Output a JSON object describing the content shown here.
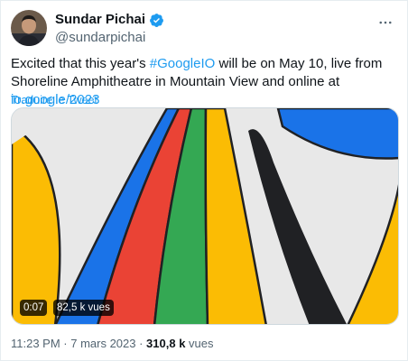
{
  "author": {
    "name": "Sundar Pichai",
    "handle": "@sundarpichai",
    "verified_color": "#1d9bf0"
  },
  "tweet": {
    "text_before": "Excited that this year's ",
    "hashtag": "#GoogleIO",
    "text_middle": " will be on May 10, live from Shoreline Amphitheatre in Mountain View and online at ",
    "url": "io.google/2023",
    "translate_label": "Traduire le Tweet"
  },
  "video": {
    "duration": "0:07",
    "views_badge": "82,5 k vues",
    "colors": {
      "blue": "#1a73e8",
      "red": "#ea4335",
      "green": "#34a853",
      "yellow": "#fbbc04",
      "black": "#202124",
      "bg": "#e8e8e8"
    }
  },
  "meta": {
    "timestamp": "11:23 PM · 7 mars 2023 · ",
    "view_count": "310,8 k",
    "views_label": " vues"
  },
  "icons": {
    "more": "more-horizontal-icon",
    "verified": "verified-badge-icon"
  }
}
